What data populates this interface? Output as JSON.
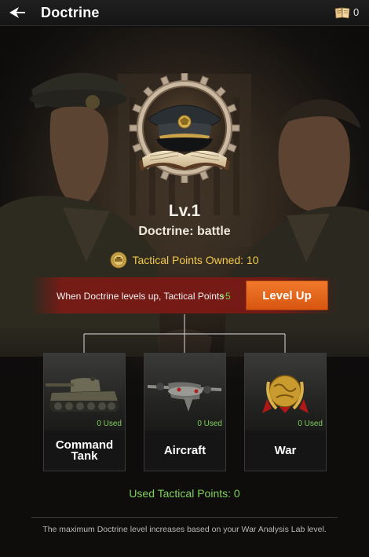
{
  "header": {
    "title": "Doctrine",
    "back_icon": "back-arrow-icon",
    "book_icon": "doctrine-book-icon",
    "book_count": "0"
  },
  "doctrine": {
    "level": "Lv.1",
    "name": "Doctrine: battle",
    "tactical_points_owned": "Tactical Points Owned: 10"
  },
  "level_up": {
    "description": "When Doctrine levels up, Tactical Points",
    "bonus": "+5",
    "button_label": "Level Up"
  },
  "branches": [
    {
      "name": "Command\nTank",
      "used": "0 Used",
      "icon": "tank-icon"
    },
    {
      "name": "Aircraft",
      "used": "0 Used",
      "icon": "aircraft-icon"
    },
    {
      "name": "War",
      "used": "0 Used",
      "icon": "globe-laurel-icon"
    }
  ],
  "used_total": "Used Tactical Points: 0",
  "footnote": "The maximum Doctrine level increases based on your War Analysis Lab level.",
  "colors": {
    "accent_orange": "#e0631a",
    "green": "#7fd25a",
    "gold": "#f2c94c",
    "band_red": "#7d1814"
  }
}
